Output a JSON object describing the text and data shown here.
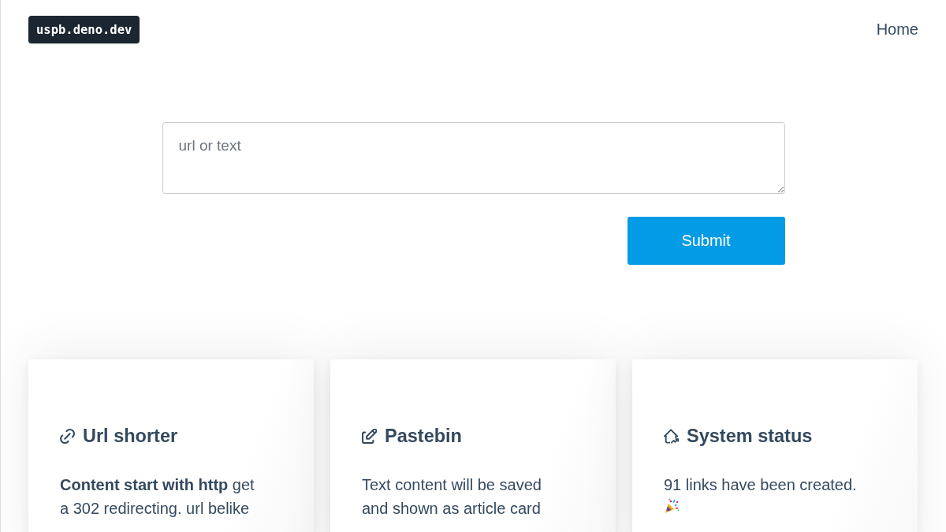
{
  "header": {
    "logo": "uspb.deno.dev",
    "nav": [
      {
        "label": "Home"
      }
    ]
  },
  "form": {
    "input": {
      "placeholder": "url or text"
    },
    "submit": "Submit"
  },
  "cards": [
    {
      "kind": "shortener",
      "title": "Url shorter",
      "body": "**Content start with http** get a 302 redirecting. url belike"
    },
    {
      "kind": "pastebin",
      "title": "Pastebin",
      "body": "Text content will be saved and shown as article card"
    },
    {
      "kind": "status",
      "title": "System status",
      "body": "91 links have been created."
    }
  ]
}
